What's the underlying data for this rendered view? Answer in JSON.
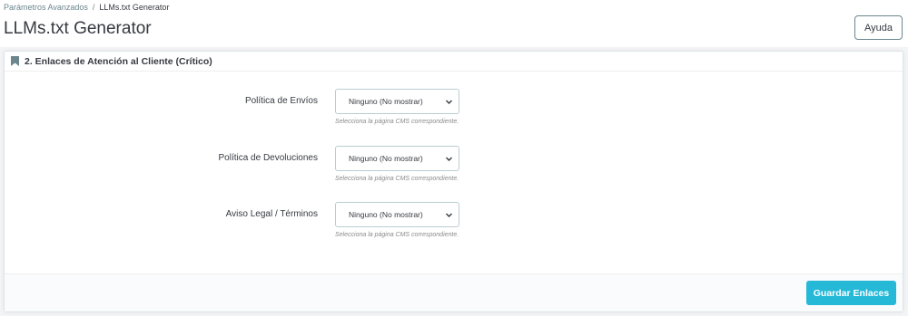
{
  "header": {
    "breadcrumb": {
      "parent": "Parámetros Avanzados",
      "separator": "/",
      "current": "LLMs.txt Generator"
    },
    "title": "LLMs.txt Generator",
    "help_label": "Ayuda"
  },
  "panel": {
    "heading": "2. Enlaces de Atención al Cliente (Crítico)",
    "heading_icon": "bookmark-icon",
    "fields": [
      {
        "label": "Política de Envíos",
        "selected": "Ninguno (No mostrar)",
        "help": "Selecciona la página CMS correspondiente."
      },
      {
        "label": "Política de Devoluciones",
        "selected": "Ninguno (No mostrar)",
        "help": "Selecciona la página CMS correspondiente."
      },
      {
        "label": "Aviso Legal / Términos",
        "selected": "Ninguno (No mostrar)",
        "help": "Selecciona la página CMS correspondiente."
      }
    ],
    "save_label": "Guardar Enlaces"
  },
  "colors": {
    "accent": "#25b9d7",
    "text": "#363a41",
    "muted": "#6c868e",
    "border": "#bbcdd2"
  }
}
